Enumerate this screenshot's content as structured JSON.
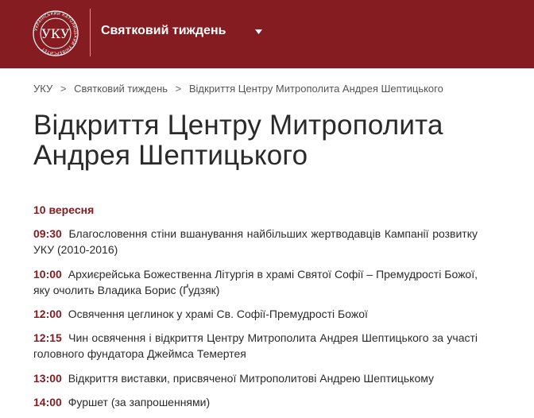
{
  "header": {
    "site_title": "Святковий тиждень",
    "logo_text": "УКУ",
    "logo_ring_text": "УКРАЇНСЬКИЙ КАТОЛИЦЬКИЙ УНІВЕРСИТЕТ",
    "brand_color": "#851c21",
    "menu_icon": "chevron-down-icon"
  },
  "breadcrumb": {
    "items": [
      "УКУ",
      "Святковий тиждень",
      "Відкриття Центру Митрополита Андрея Шептицького"
    ],
    "separator": ">"
  },
  "page": {
    "title": "Відкриття Центру Митрополита Андрея Шептицького",
    "date": "10 вересня",
    "schedule": [
      {
        "time": "09:30",
        "text": "Благословення стіни вшанування найбільших жертводавців Кампанії розвитку УКУ (2010-2016)"
      },
      {
        "time": "10:00",
        "text": "Архиєрейська Божественна Літургія в храмі Святої Софії – Премудрості Божої, яку очолить Владика Борис (Ґудзяк)"
      },
      {
        "time": "12:00",
        "text": "Освячення цеглинок у храмі Св. Софії-Премудрості Божої"
      },
      {
        "time": "12:15",
        "text": "Чин освячення і відкриття Центру Митрополита Андрея Шептицького за участі головного фундатора Джеймса Темертея"
      },
      {
        "time": "13:00",
        "text": "Відкриття виставки, присвяченої Митрополитові Андрею Шептицькому"
      },
      {
        "time": "14:00",
        "text": "Фуршет (за запрошеннями)"
      }
    ]
  }
}
